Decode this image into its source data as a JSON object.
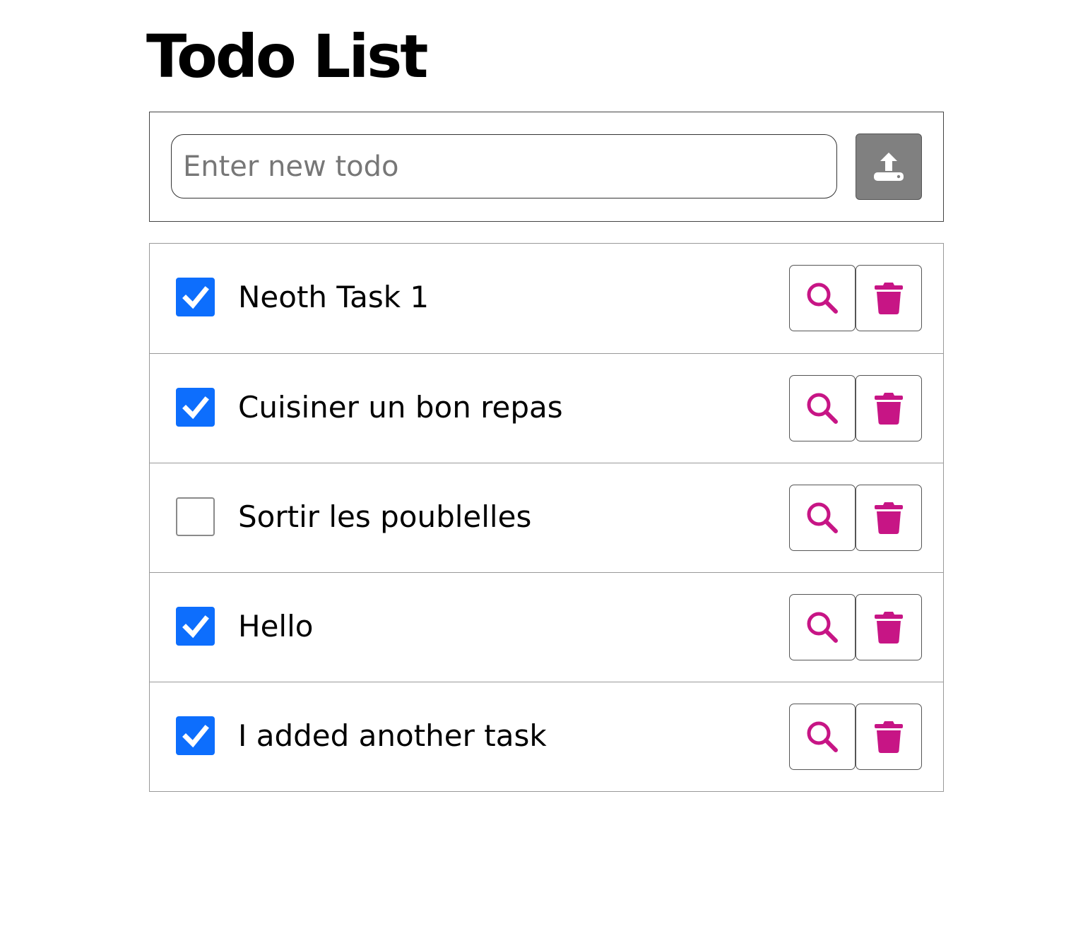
{
  "page": {
    "title": "Todo List"
  },
  "add_todo": {
    "placeholder": "Enter new todo",
    "value": "",
    "submit_icon": "upload-icon",
    "submit_color": "#808080"
  },
  "todos": [
    {
      "label": "Neoth Task 1",
      "checked": true
    },
    {
      "label": "Cuisiner un bon repas",
      "checked": true
    },
    {
      "label": "Sortir les poublelles",
      "checked": false
    },
    {
      "label": "Hello",
      "checked": true
    },
    {
      "label": "I added another task",
      "checked": true
    }
  ],
  "row_actions": {
    "view_icon": "search-icon",
    "delete_icon": "trash-icon",
    "icon_color": "#c71585"
  },
  "colors": {
    "checkbox_checked": "#0d6efd",
    "accent": "#c71585"
  }
}
